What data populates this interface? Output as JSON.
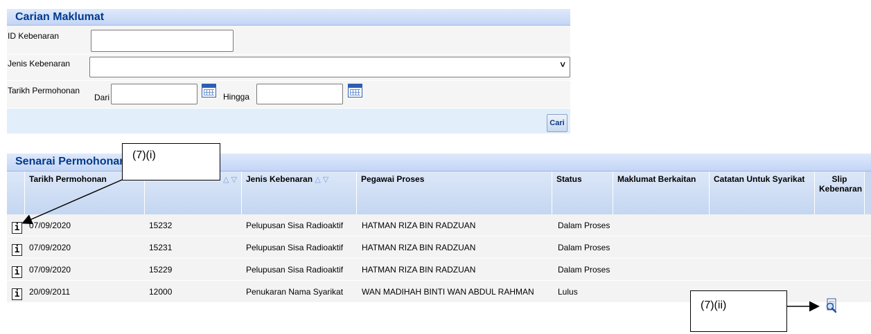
{
  "search": {
    "title": "Carian Maklumat",
    "id_label": "ID Kebenaran",
    "id_value": "",
    "jenis_label": "Jenis Kebenaran",
    "jenis_value": "",
    "tarikh_label": "Tarikh Permohonan",
    "dari_label": "Dari",
    "dari_value": "",
    "hingga_label": "Hingga",
    "hingga_value": "",
    "cari_label": "Cari"
  },
  "list": {
    "title": "Senarai Permohonan",
    "columns": {
      "tarikh": "Tarikh Permohonan",
      "jenis": "Jenis Kebenaran",
      "pegawai": "Pegawai Proses",
      "status": "Status",
      "maklumat": "Maklumat Berkaitan",
      "catatan": "Catatan Untuk Syarikat",
      "slip_line1": "Slip",
      "slip_line2": "Kebenaran"
    },
    "sort_glyph": "△ ▽",
    "rows": [
      {
        "tarikh": "07/09/2020",
        "id": "15232",
        "jenis": "Pelupusan Sisa Radioaktif",
        "pegawai": "HATMAN RIZA BIN RADZUAN",
        "status": "Dalam Proses"
      },
      {
        "tarikh": "07/09/2020",
        "id": "15231",
        "jenis": "Pelupusan Sisa Radioaktif",
        "pegawai": "HATMAN RIZA BIN RADZUAN",
        "status": "Dalam Proses"
      },
      {
        "tarikh": "07/09/2020",
        "id": "15229",
        "jenis": "Pelupusan Sisa Radioaktif",
        "pegawai": "HATMAN RIZA BIN RADZUAN",
        "status": "Dalam Proses"
      },
      {
        "tarikh": "20/09/2011",
        "id": "12000",
        "jenis": "Penukaran Nama Syarikat",
        "pegawai": "WAN MADIHAH BINTI WAN ABDUL RAHMAN",
        "status": "Lulus"
      }
    ],
    "info_glyph": "i",
    "slip_icon": "magnifier-document-icon"
  },
  "annotations": {
    "first": "(7)(i)",
    "second": "(7)(ii)"
  },
  "colors": {
    "header_text": "#003a8c",
    "header_bg": "#c3d5f6",
    "row_bg": "#f3f3f3",
    "cari_text": "#0b3a86"
  }
}
